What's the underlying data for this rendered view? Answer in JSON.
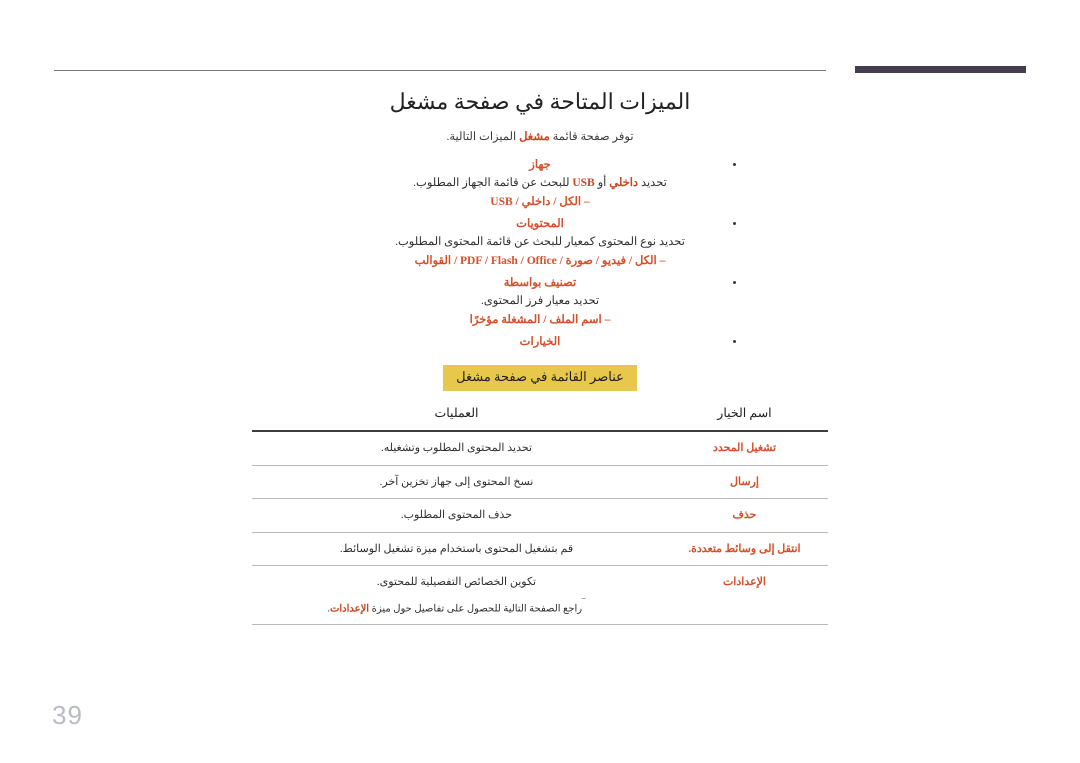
{
  "document": {
    "page_number": "39",
    "title": "الميزات المتاحة في صفحة مشغل",
    "subtitle_before": "توفر صفحة قائمة ",
    "subtitle_keyword": "مشغل",
    "subtitle_after": " الميزات التالية."
  },
  "colors": {
    "accent": "#d4502a",
    "section_bar_bg": "#e8c84b",
    "top_bar": "#463c4f",
    "page_number": "#b9bcc4"
  },
  "features": [
    {
      "head": "جهاز",
      "desc_parts": [
        {
          "text": "تحديد ",
          "style": "plain"
        },
        {
          "text": "داخلي",
          "style": "accent"
        },
        {
          "text": " أو ",
          "style": "plain"
        },
        {
          "text": "USB",
          "style": "accent"
        },
        {
          "text": " للبحث عن قائمة الجهاز المطلوب.",
          "style": "plain"
        }
      ],
      "sub": "– الكل / داخلي / USB"
    },
    {
      "head": "المحتويات",
      "desc_parts": [
        {
          "text": "تحديد نوع المحتوى كمعيار للبحث عن قائمة المحتوى المطلوب.",
          "style": "plain"
        }
      ],
      "sub": "– الكل / فيديو / صورة / PDF / Flash / Office / القوالب"
    },
    {
      "head": "تصنيف بواسطة",
      "desc_parts": [
        {
          "text": "تحديد معيار فرز المحتوى.",
          "style": "plain"
        }
      ],
      "sub": "– اسم الملف / المشغلة مؤخرًا"
    },
    {
      "head": "الخيارات",
      "desc_parts": [],
      "sub": ""
    }
  ],
  "section": {
    "bar_label": "عناصر القائمة في صفحة مشغل"
  },
  "table": {
    "headers": {
      "name": "اسم الخيار",
      "operations": "العمليات"
    },
    "rows": [
      {
        "name": "تشغيل المحدد",
        "operations": "تحديد المحتوى المطلوب وتشغيله."
      },
      {
        "name": "إرسال",
        "operations": "نسخ المحتوى إلى جهاز تخزين آخر."
      },
      {
        "name": "حذف",
        "operations": "حذف المحتوى المطلوب."
      },
      {
        "name": "انتقل إلى وسائط متعددة.",
        "operations": "قم بتشغيل المحتوى باستخدام ميزة تشغيل الوسائط."
      },
      {
        "name": "الإعدادات",
        "operations": "تكوين الخصائص التفصيلية للمحتوى."
      }
    ],
    "footnote": {
      "mark": "‾",
      "before": "راجع الصفحة التالية للحصول على تفاصيل حول ميزة ",
      "keyword": "الإعدادات",
      "after": "."
    }
  }
}
